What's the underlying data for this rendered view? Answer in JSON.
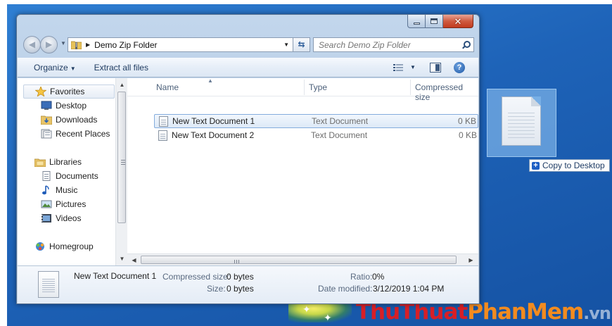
{
  "window": {
    "address": {
      "folder": "Demo Zip Folder"
    },
    "search": {
      "placeholder": "Search Demo Zip Folder"
    },
    "commands": {
      "organize": "Organize",
      "extract_all": "Extract all files"
    },
    "nav": {
      "favorites": {
        "label": "Favorites",
        "items": [
          "Desktop",
          "Downloads",
          "Recent Places"
        ]
      },
      "libraries": {
        "label": "Libraries",
        "items": [
          "Documents",
          "Music",
          "Pictures",
          "Videos"
        ]
      },
      "homegroup": "Homegroup"
    },
    "columns": {
      "name": "Name",
      "type": "Type",
      "compressed_size": "Compressed size"
    },
    "files": [
      {
        "name": "New Text Document 1",
        "type": "Text Document",
        "size": "0 KB",
        "selected": true
      },
      {
        "name": "New Text Document 2",
        "type": "Text Document",
        "size": "0 KB",
        "selected": false
      }
    ],
    "details": {
      "name": "New Text Document 1",
      "compressed_label": "Compressed size:",
      "compressed_value": "0 bytes",
      "size_label": "Size:",
      "size_value": "0 bytes",
      "ratio_label": "Ratio:",
      "ratio_value": "0%",
      "modified_label": "Date modified:",
      "modified_value": "3/12/2019 1:04 PM"
    }
  },
  "drag": {
    "tooltip": "Copy to Desktop"
  },
  "watermark": {
    "part1": "Thu",
    "part2": "Thuat",
    "part3": "PhanMem",
    "part4": ".vn"
  },
  "colors": {
    "selection_border": "#84acdd",
    "watermark_red": "#d81f26",
    "watermark_orange": "#f28b1f",
    "desktop_blue": "#1e63b8"
  },
  "icons": {
    "favorites": "star-icon",
    "desktop": "desktop-icon",
    "downloads": "downloads-folder-icon",
    "recent": "recent-places-icon",
    "libraries": "libraries-icon",
    "documents": "documents-icon",
    "music": "music-note-icon",
    "pictures": "pictures-icon",
    "videos": "videos-icon",
    "homegroup": "homegroup-icon"
  }
}
